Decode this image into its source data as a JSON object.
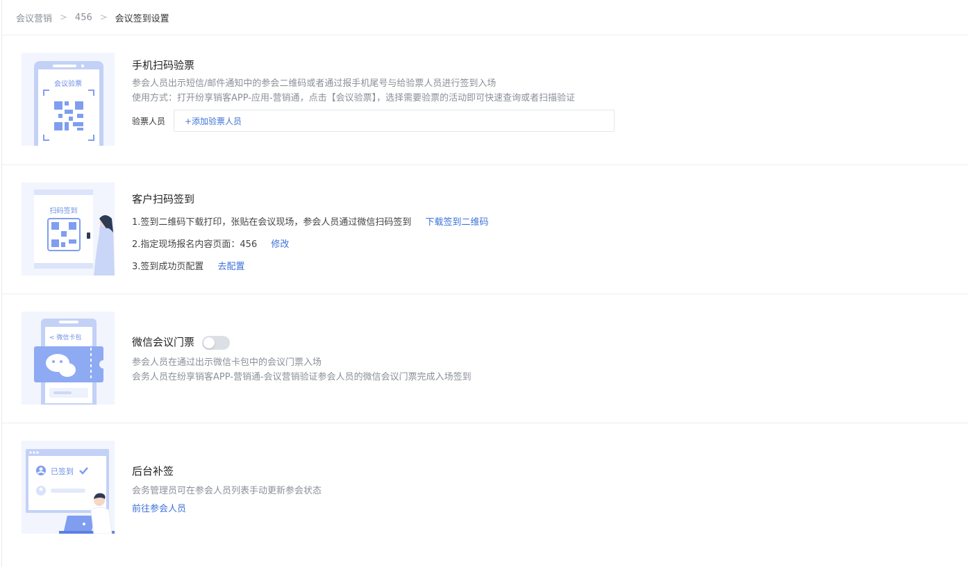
{
  "breadcrumb": {
    "items": [
      "会议营销",
      "456",
      "会议签到设置"
    ],
    "separator": ">"
  },
  "sections": {
    "mobile_scan": {
      "illus_label": "会议验票",
      "title": "手机扫码验票",
      "desc1": "参会人员出示短信/邮件通知中的参会二维码或者通过报手机尾号与给验票人员进行签到入场",
      "desc2": "使用方式：打开纷享销客APP-应用-营销通，点击【会议验票】，选择需要验票的活动即可快速查询或者扫描验证",
      "field_label": "验票人员",
      "add_link": "+添加验票人员"
    },
    "customer_scan": {
      "illus_label": "扫码签到",
      "title": "客户扫码签到",
      "step1": "1.签到二维码下载打印，张贴在会议现场，参会人员通过微信扫码签到",
      "step1_link": "下载签到二维码",
      "step2": "2.指定现场报名内容页面：456",
      "step2_link": "修改",
      "step3": "3.签到成功页配置",
      "step3_link": "去配置"
    },
    "wechat_ticket": {
      "illus_label": "< 微信卡包",
      "title": "微信会议门票",
      "toggle_on": false,
      "desc1": "参会人员在通过出示微信卡包中的会议门票入场",
      "desc2": "会务人员在纷享销客APP-营销通-会议营销验证参会人员的微信会议门票完成入场签到"
    },
    "backend": {
      "illus_label": "已签到",
      "title": "后台补签",
      "desc": "会务管理员可在参会人员列表手动更新参会状态",
      "link": "前往参会人员"
    }
  },
  "colors": {
    "accent": "#3f72d8",
    "illus_bg": "#f2f5fd",
    "illus_blue": "#7f9ef0"
  }
}
